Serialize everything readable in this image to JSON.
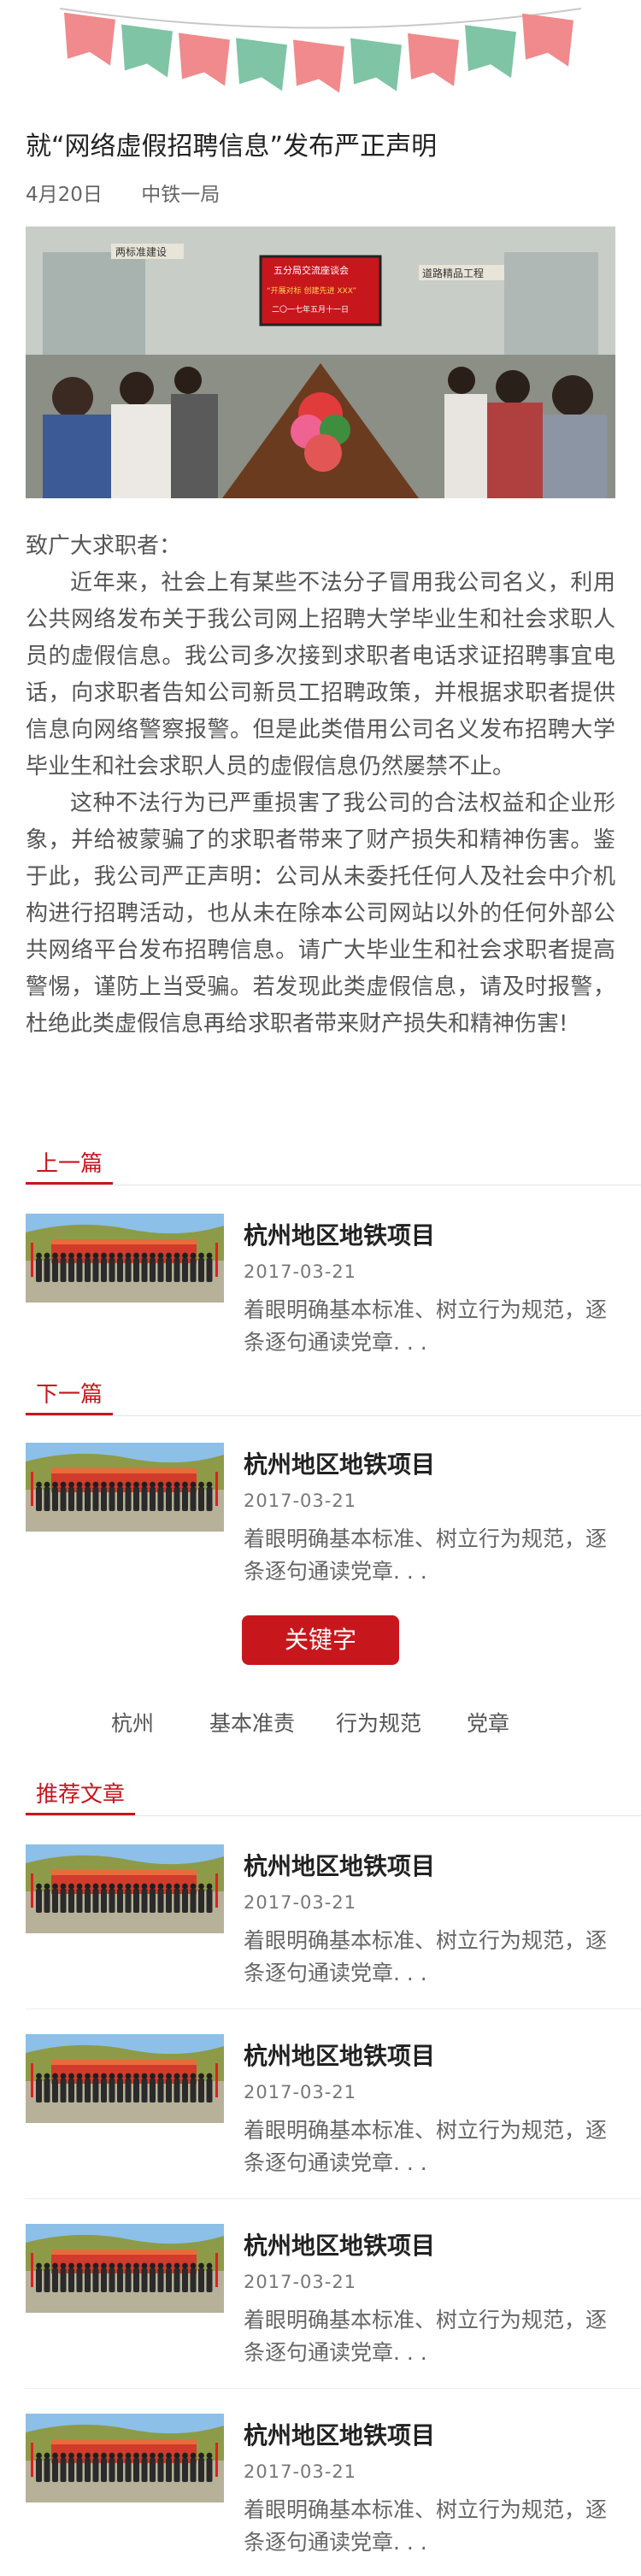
{
  "article": {
    "title": "就“网络虚假招聘信息”发布严正声明",
    "date": "4月20日",
    "source": "中铁一局",
    "hero_banner": {
      "line1": "五分局交流座谈会",
      "line2": "“开展对标  创建先进 XXX”",
      "line3": "二〇一七年五月十一日",
      "wall_left": "两标准建设",
      "wall_right": "道路精品工程"
    },
    "greeting": "致广大求职者：",
    "paragraphs": [
      "近年来，社会上有某些不法分子冒用我公司名义，利用公共网络发布关于我公司网上招聘大学毕业生和社会求职人员的虚假信息。我公司多次接到求职者电话求证招聘事宜电话，向求职者告知公司新员工招聘政策，并根据求职者提供信息向网络警察报警。但是此类借用公司名义发布招聘大学毕业生和社会求职人员的虚假信息仍然屡禁不止。",
      "这种不法行为已严重损害了我公司的合法权益和企业形象，并给被蒙骗了的求职者带来了财产损失和精神伤害。鉴于此，我公司严正声明：公司从未委托任何人及社会中介机构进行招聘活动，也从未在除本公司网站以外的任何外部公共网络平台发布招聘信息。请广大毕业生和社会求职者提高警惕，谨防上当受骗。若发现此类虚假信息，请及时报警，杜绝此类虚假信息再给求职者带来财产损失和精神伤害!"
    ]
  },
  "prev": {
    "label": "上一篇",
    "title": "杭州地区地铁项目",
    "date": "2017-03-21",
    "desc": "着眼明确基本标准、树立行为规范，逐条逐句通读党章. . ."
  },
  "next": {
    "label": "下一篇",
    "title": "杭州地区地铁项目",
    "date": "2017-03-21",
    "desc": "着眼明确基本标准、树立行为规范，逐条逐句通读党章. . ."
  },
  "keywords": {
    "button": "关键字",
    "tags": [
      "杭州",
      "基本准责",
      "行为规范",
      "党章"
    ]
  },
  "recommend": {
    "label": "推荐文章",
    "items": [
      {
        "title": "杭州地区地铁项目",
        "date": "2017-03-21",
        "desc": "着眼明确基本标准、树立行为规范，逐条逐句通读党章. . ."
      },
      {
        "title": "杭州地区地铁项目",
        "date": "2017-03-21",
        "desc": "着眼明确基本标准、树立行为规范，逐条逐句通读党章. . ."
      },
      {
        "title": "杭州地区地铁项目",
        "date": "2017-03-21",
        "desc": "着眼明确基本标准、树立行为规范，逐条逐句通读党章. . ."
      },
      {
        "title": "杭州地区地铁项目",
        "date": "2017-03-21",
        "desc": "着眼明确基本标准、树立行为规范，逐条逐句通读党章. . ."
      }
    ]
  },
  "colors": {
    "accent": "#c8161d",
    "flag_pink": "#f08a8c",
    "flag_green": "#7fc4a5"
  }
}
